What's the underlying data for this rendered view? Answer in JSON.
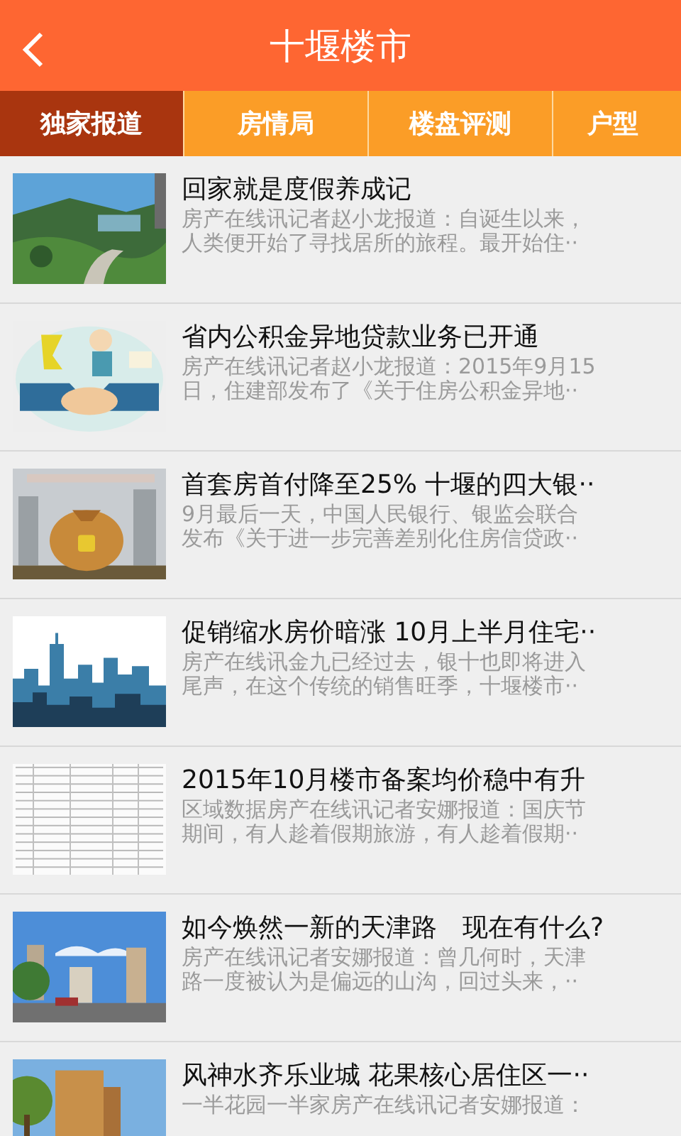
{
  "header": {
    "title": "十堰楼市"
  },
  "tabs": [
    {
      "label": "独家报道",
      "selected": true
    },
    {
      "label": "房情局",
      "selected": false
    },
    {
      "label": "楼盘评测",
      "selected": false
    },
    {
      "label": "户型",
      "selected": false
    }
  ],
  "articles": [
    {
      "title": "回家就是度假养成记",
      "summary": [
        "房产在线讯记者赵小龙报道：自诞生以来，",
        "人类便开始了寻找居所的旅程。最开始住··"
      ]
    },
    {
      "title": "省内公积金异地贷款业务已开通",
      "summary": [
        "房产在线讯记者赵小龙报道：2015年9月15",
        "日，住建部发布了《关于住房公积金异地··"
      ]
    },
    {
      "title": "首套房首付降至25% 十堰的四大银··",
      "summary": [
        "9月最后一天，中国人民银行、银监会联合",
        "发布《关于进一步完善差别化住房信贷政··"
      ]
    },
    {
      "title": "促销缩水房价暗涨 10月上半月住宅··",
      "summary": [
        "房产在线讯金九已经过去，银十也即将进入",
        "尾声，在这个传统的销售旺季，十堰楼市··"
      ]
    },
    {
      "title": "2015年10月楼市备案均价稳中有升",
      "summary": [
        "区域数据房产在线讯记者安娜报道：国庆节",
        "期间，有人趁着假期旅游，有人趁着假期··"
      ]
    },
    {
      "title": "如今焕然一新的天津路　现在有什么?",
      "summary": [
        "房产在线讯记者安娜报道：曾几何时，天津",
        "路一度被认为是偏远的山沟，回过头来，··"
      ]
    },
    {
      "title": "风神水齐乐业城 花果核心居住区一··",
      "summary": [
        "一半花园一半家房产在线讯记者安娜报道："
      ]
    }
  ]
}
